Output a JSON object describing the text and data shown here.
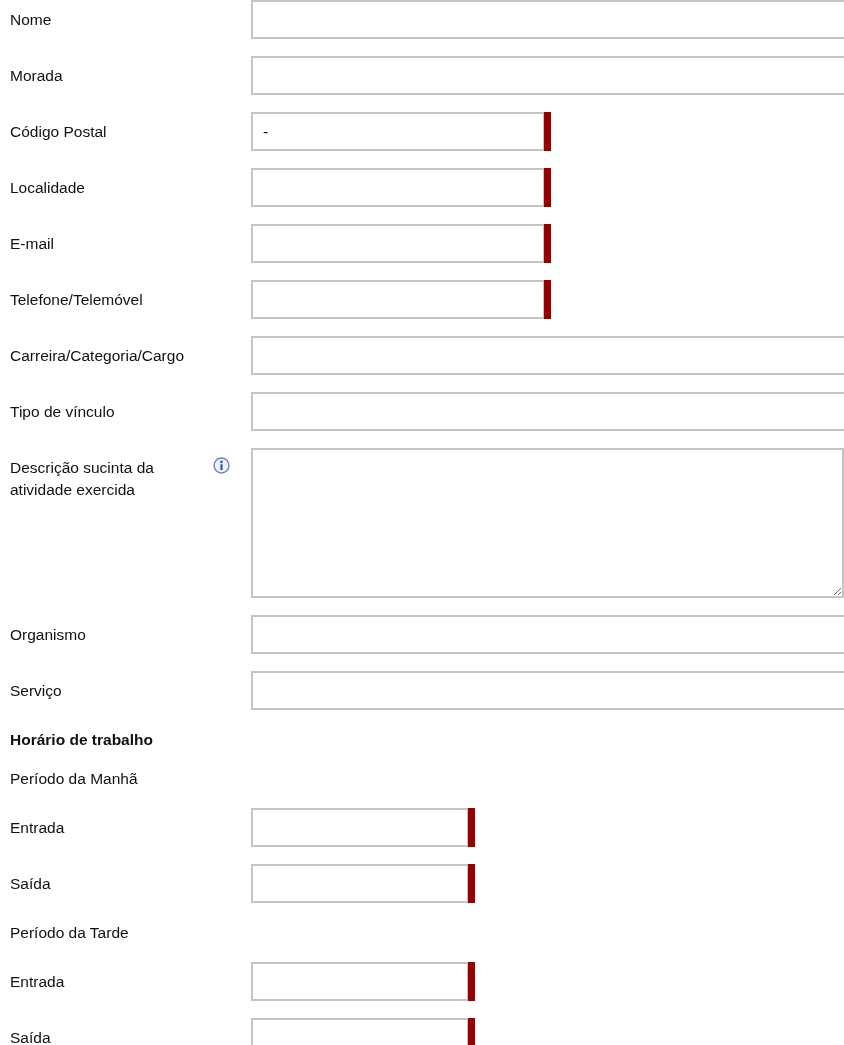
{
  "rows": [
    {
      "kind": "wide",
      "label": "Nome",
      "required": false
    },
    {
      "kind": "wide",
      "label": "Morada",
      "required": false
    },
    {
      "kind": "medium",
      "label": "Código Postal",
      "required": true,
      "value": "-"
    },
    {
      "kind": "medium",
      "label": "Localidade",
      "required": true
    },
    {
      "kind": "medium",
      "label": "E-mail",
      "required": true
    },
    {
      "kind": "medium",
      "label": "Telefone/Telemóvel",
      "required": true
    },
    {
      "kind": "wide",
      "label": "Carreira/Categoria/Cargo",
      "required": false
    },
    {
      "kind": "wide",
      "label": "Tipo de vínculo",
      "required": false
    },
    {
      "kind": "textarea",
      "label": "Descrição sucinta da atividade exercida",
      "info": true
    },
    {
      "kind": "wide",
      "label": "Organismo",
      "required": false
    },
    {
      "kind": "wide",
      "label": "Serviço",
      "required": false
    },
    {
      "kind": "heading",
      "label": "Horário de trabalho"
    },
    {
      "kind": "subheading",
      "label": "Período da Manhã"
    },
    {
      "kind": "short",
      "label": "Entrada",
      "required": true
    },
    {
      "kind": "short",
      "label": "Saída",
      "required": true
    },
    {
      "kind": "subheading",
      "label": "Período da Tarde"
    },
    {
      "kind": "short",
      "label": "Entrada",
      "required": true
    },
    {
      "kind": "short",
      "label": "Saída",
      "required": true
    }
  ]
}
